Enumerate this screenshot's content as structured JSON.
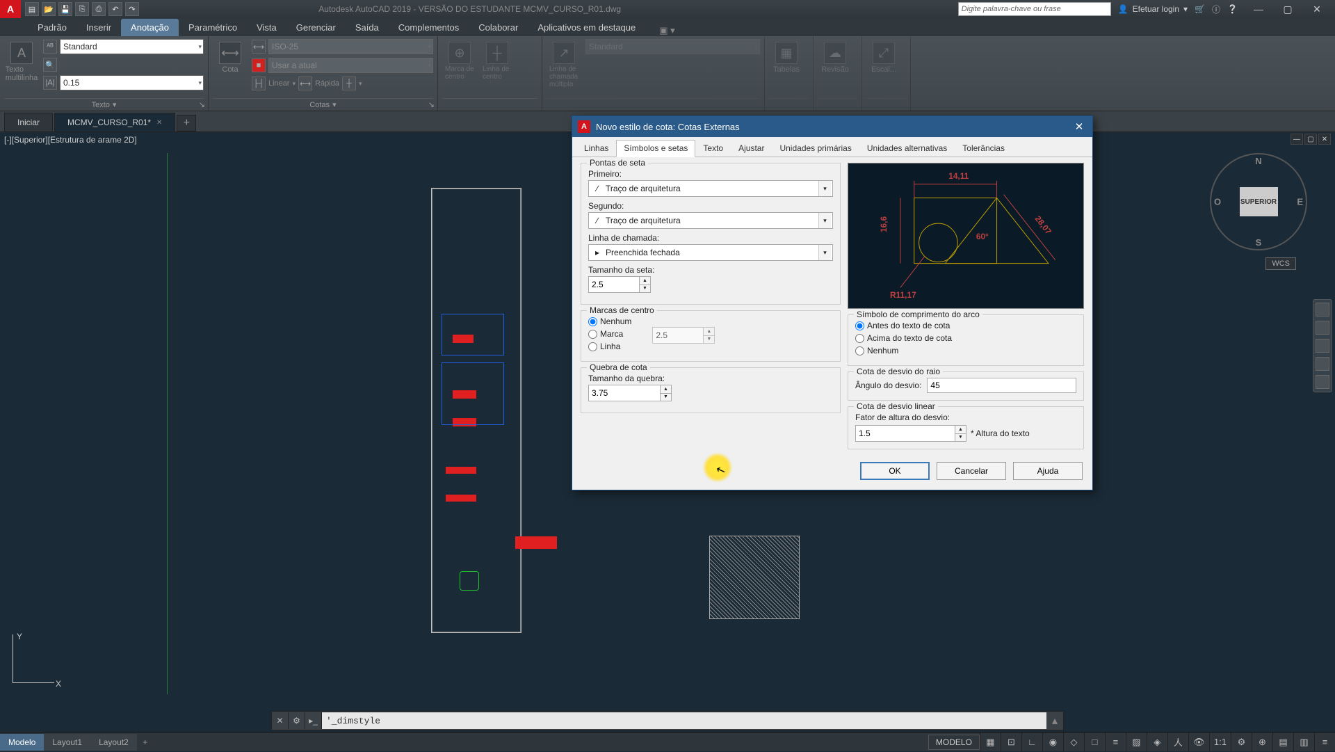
{
  "app": {
    "title": "Autodesk AutoCAD 2019 - VERSÃO DO ESTUDANTE    MCMV_CURSO_R01.dwg",
    "search_placeholder": "Digite palavra-chave ou frase",
    "login": "Efetuar login"
  },
  "ribbon": {
    "tabs": [
      "Padrão",
      "Inserir",
      "Anotação",
      "Paramétrico",
      "Vista",
      "Gerenciar",
      "Saída",
      "Complementos",
      "Colaborar",
      "Aplicativos em destaque"
    ],
    "active_tab": 2,
    "text_group": {
      "title": "Texto",
      "btn": "Texto multilinha",
      "style": "Standard",
      "height": "0.15"
    },
    "dim_group": {
      "title": "Cotas",
      "btn": "Cota",
      "style": "ISO-25",
      "layer": "Usar a atual",
      "linear": "Linear",
      "rapida": "Rápida"
    },
    "center_group": {
      "marca": "Marca de centro",
      "linha": "Linha de centro"
    },
    "leader_group": {
      "btn": "Linha de chamada múltipla",
      "style": "Standard"
    },
    "tables": "Tabelas",
    "revision": "Revisão",
    "scale": "Escal..."
  },
  "file_tabs": {
    "start": "Iniciar",
    "file": "MCMV_CURSO_R01*"
  },
  "viewport": {
    "label": "[-][Superior][Estrutura de arame 2D]",
    "cube_face": "SUPERIOR",
    "cube_dirs": {
      "n": "N",
      "s": "S",
      "e": "E",
      "o": "O"
    },
    "wcs": "WCS"
  },
  "cmdline": {
    "value": "'_dimstyle"
  },
  "statusbar": {
    "model": "Modelo",
    "layout1": "Layout1",
    "layout2": "Layout2",
    "modelo": "MODELO",
    "ratio": "1:1"
  },
  "dialog": {
    "title": "Novo estilo de cota: Cotas Externas",
    "tabs": [
      "Linhas",
      "Símbolos e setas",
      "Texto",
      "Ajustar",
      "Unidades primárias",
      "Unidades alternativas",
      "Tolerâncias"
    ],
    "active_tab": 1,
    "arrowheads": {
      "legend": "Pontas de seta",
      "first_label": "Primeiro:",
      "first_value": "Traço de arquitetura",
      "second_label": "Segundo:",
      "second_value": "Traço de arquitetura",
      "leader_label": "Linha de chamada:",
      "leader_value": "Preenchida fechada",
      "size_label": "Tamanho da seta:",
      "size_value": "2.5"
    },
    "centermarks": {
      "legend": "Marcas de centro",
      "none": "Nenhum",
      "mark": "Marca",
      "line": "Linha",
      "size": "2.5"
    },
    "dimbreak": {
      "legend": "Quebra de cota",
      "size_label": "Tamanho da quebra:",
      "size_value": "3.75"
    },
    "arclen": {
      "legend": "Símbolo de comprimento do arco",
      "before": "Antes do texto de cota",
      "above": "Acima do texto de cota",
      "none": "Nenhum"
    },
    "jog_radius": {
      "legend": "Cota de desvio do raio",
      "angle_label": "Ângulo do desvio:",
      "angle_value": "45"
    },
    "jog_linear": {
      "legend": "Cota de desvio linear",
      "factor_label": "Fator de altura do desvio:",
      "factor_value": "1.5",
      "suffix": "* Altura do texto"
    },
    "preview": {
      "top": "14,11",
      "left": "16,6",
      "right": "28,07",
      "angle": "60°",
      "radius": "R11,17"
    },
    "buttons": {
      "ok": "OK",
      "cancel": "Cancelar",
      "help": "Ajuda"
    }
  }
}
